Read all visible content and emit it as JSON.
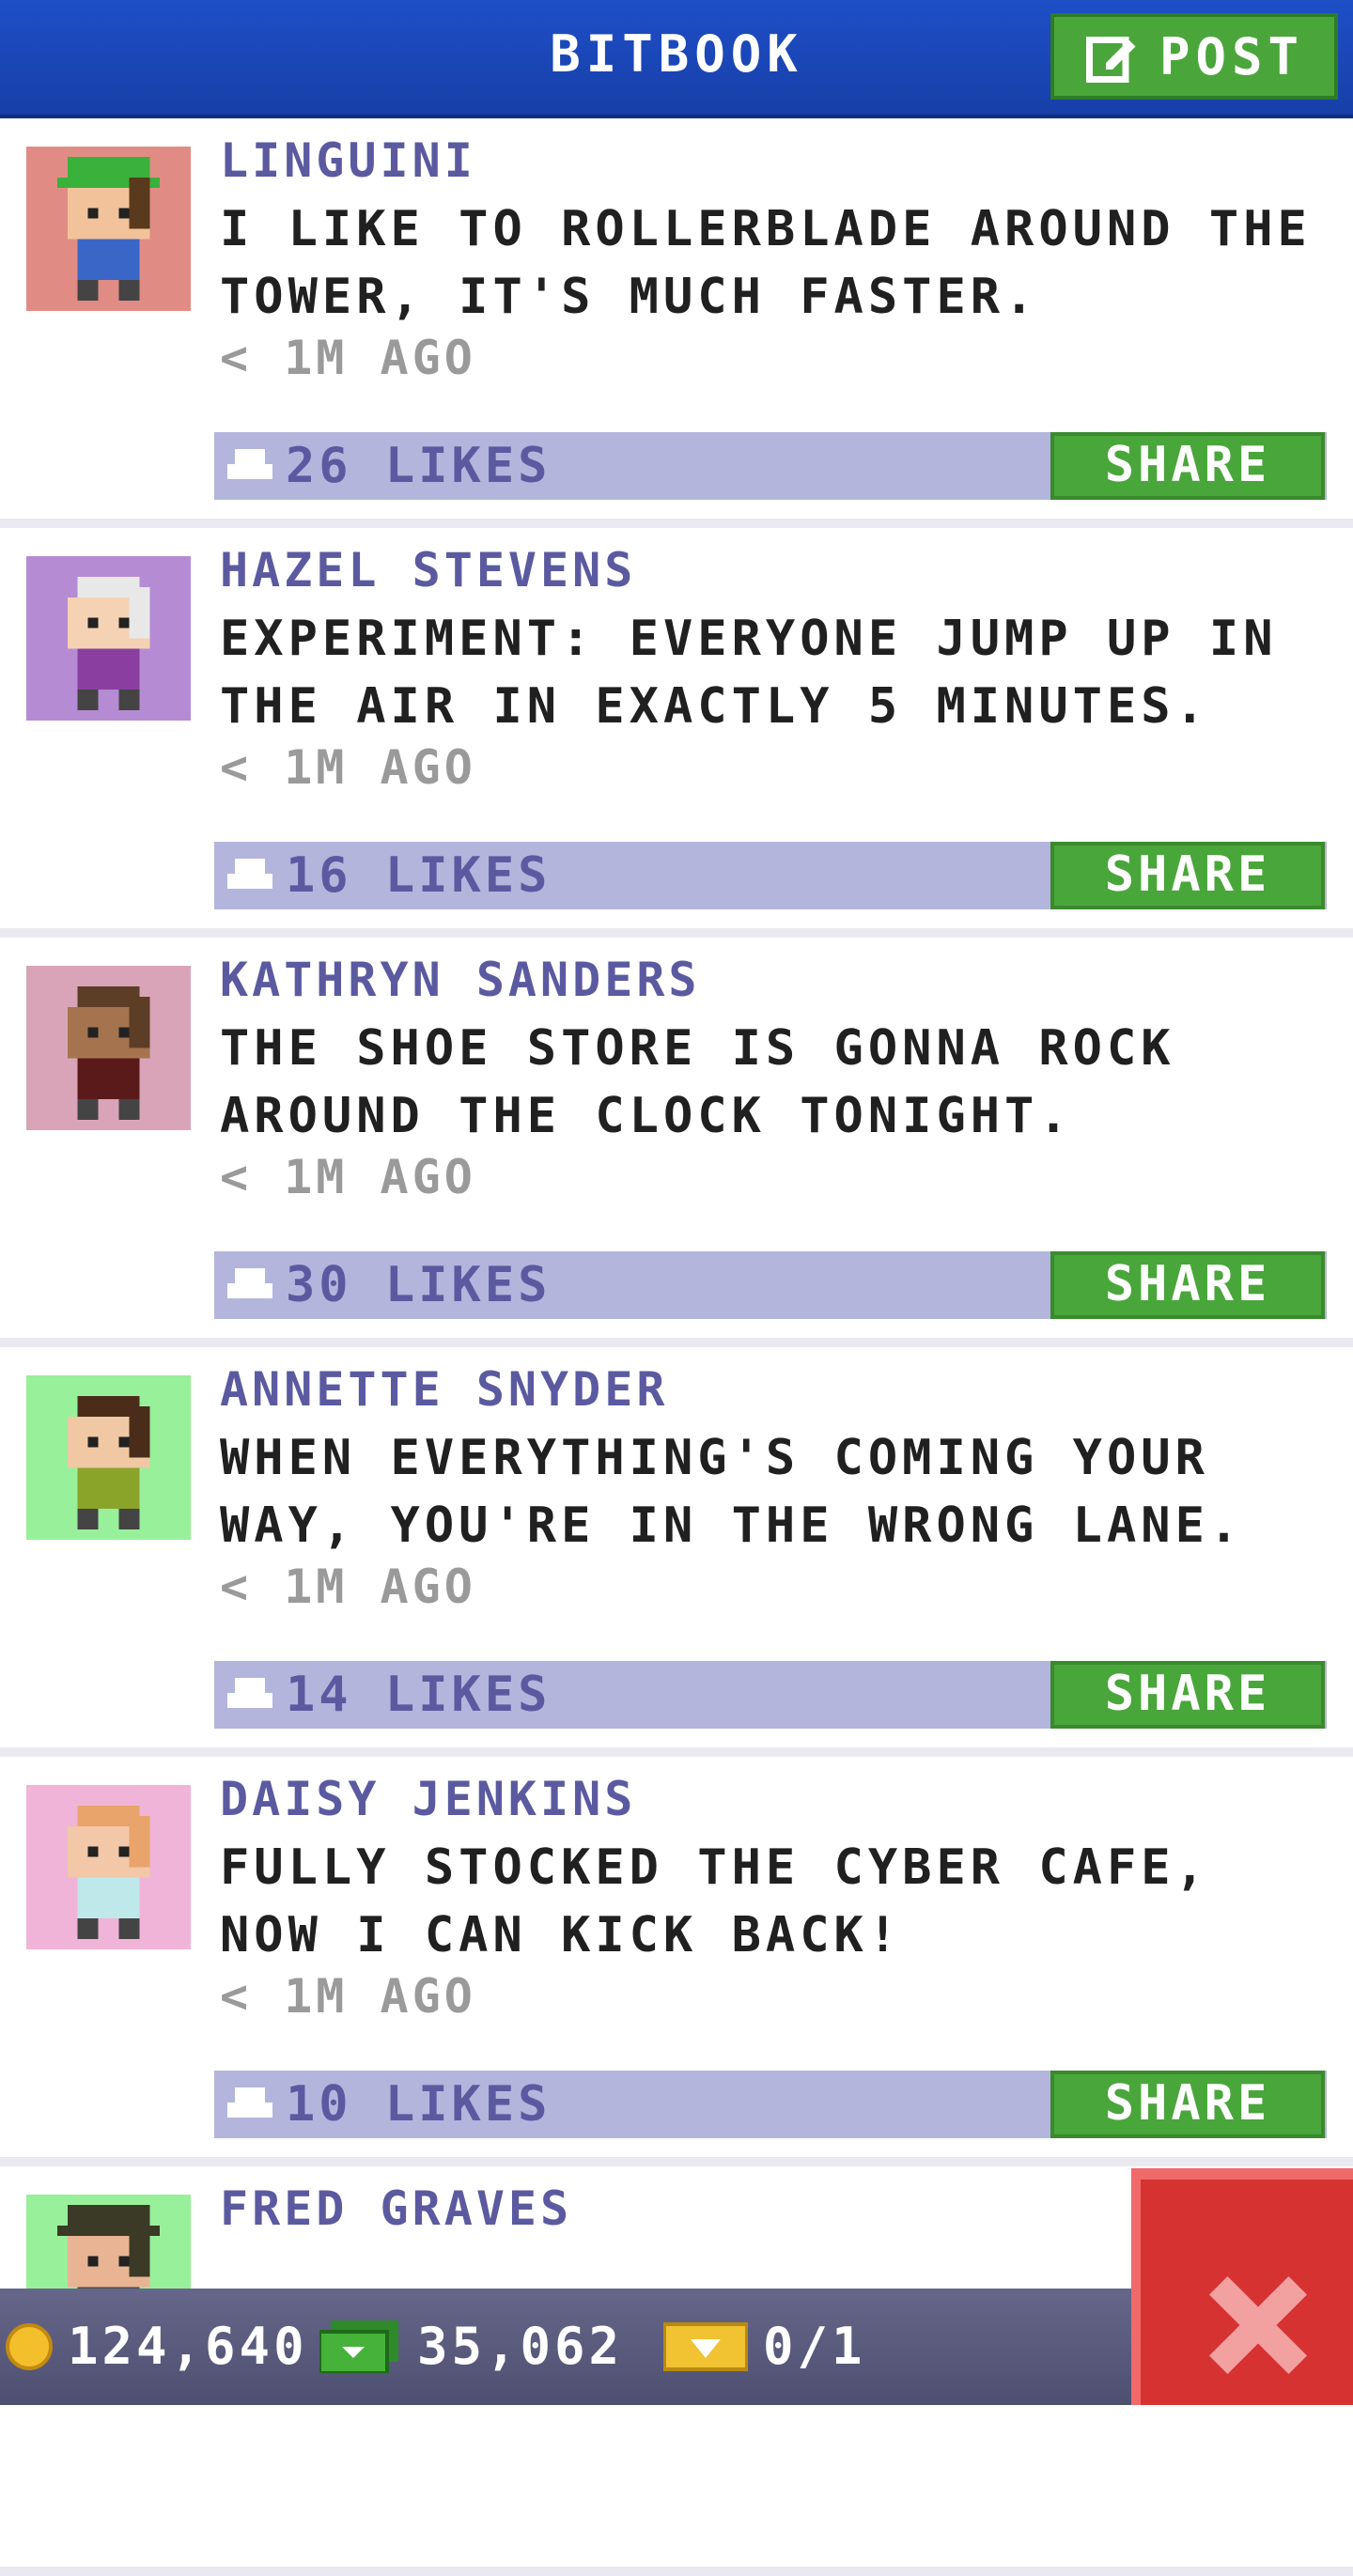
{
  "header": {
    "title": "BITBOOK",
    "post_label": "POST"
  },
  "posts": [
    {
      "name": "LINGUINI",
      "text": "I LIKE TO ROLLERBLADE AROUND THE TOWER, IT'S MUCH FASTER.",
      "time": "< 1M AGO",
      "likes": "26 LIKES",
      "share": "SHARE",
      "avatar_bg": "#e08c84",
      "skin": "#f2c39a",
      "hair": "#5a3a1c",
      "shirt": "#3a66c8",
      "hat": "#3ab13a"
    },
    {
      "name": "HAZEL STEVENS",
      "text": "EXPERIMENT: EVERYONE JUMP UP IN THE AIR IN EXACTLY 5 MINUTES.",
      "time": "< 1M AGO",
      "likes": "16 LIKES",
      "share": "SHARE",
      "avatar_bg": "#b58bd4",
      "skin": "#f5d2b3",
      "hair": "#e8e8e8",
      "shirt": "#8a3fa0"
    },
    {
      "name": "KATHRYN SANDERS",
      "text": "THE SHOE STORE IS GONNA ROCK AROUND THE CLOCK TONIGHT.",
      "time": "< 1M AGO",
      "likes": "30 LIKES",
      "share": "SHARE",
      "avatar_bg": "#d9a4b8",
      "skin": "#a5744f",
      "hair": "#5c3d26",
      "shirt": "#5a1a1a"
    },
    {
      "name": "ANNETTE SNYDER",
      "text": "WHEN EVERYTHING'S COMING YOUR WAY, YOU'RE IN THE WRONG LANE.",
      "time": "< 1M AGO",
      "likes": "14 LIKES",
      "share": "SHARE",
      "avatar_bg": "#98f09a",
      "skin": "#f0c8a4",
      "hair": "#4a2c1a",
      "shirt": "#8aa42a"
    },
    {
      "name": "DAISY JENKINS",
      "text": "FULLY STOCKED THE CYBER CAFE, NOW I CAN KICK BACK!",
      "time": "< 1M AGO",
      "likes": "10 LIKES",
      "share": "SHARE",
      "avatar_bg": "#f0b4d8",
      "skin": "#f2c8a8",
      "hair": "#e8a46a",
      "shirt": "#bfe8ea"
    },
    {
      "name": "FRED GRAVES",
      "text": "",
      "time": "",
      "likes": "",
      "share": "",
      "avatar_bg": "#98f09a",
      "skin": "#e8b494",
      "hair": "#3a3a26",
      "shirt": "#4a4a4a",
      "hat": "#3a3a26"
    }
  ],
  "bottom_bar": {
    "coins": "124,640",
    "bux": "35,062",
    "tickets": "0/1"
  },
  "colors": {
    "header": "#1e4fc7",
    "share_green": "#49a63a",
    "like_bar": "#b3b5dc",
    "close_red": "#d63232"
  },
  "icons": {
    "post": "edit-icon",
    "like": "thumbs-up-icon",
    "coins": "coin-icon",
    "bux": "bux-icon",
    "tickets": "ticket-icon",
    "close": "close-icon"
  }
}
